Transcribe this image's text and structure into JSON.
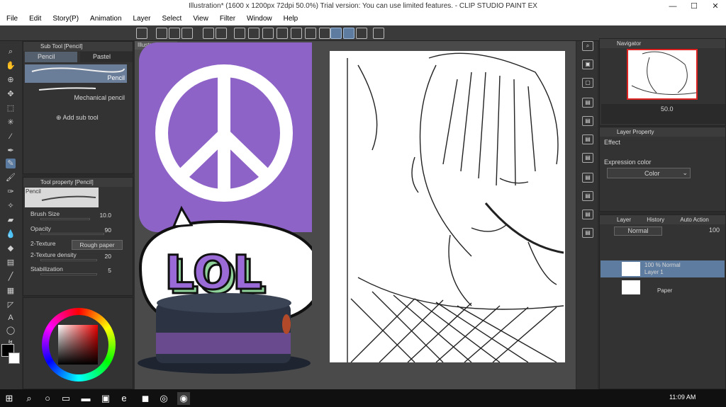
{
  "titlebar": {
    "title": "Illustration* (1600 x 1200px 72dpi 50.0%)  Trial version: You can use limited features. - CLIP STUDIO PAINT EX",
    "minimize": "—",
    "maximize": "☐",
    "close": "✕"
  },
  "menu": {
    "items": [
      "File",
      "Edit",
      "Story(P)",
      "Animation",
      "Layer",
      "Select",
      "View",
      "Filter",
      "Window",
      "Help"
    ]
  },
  "subtool": {
    "header": "Sub Tool [Pencil]",
    "tabs": [
      "Pencil",
      "Pastel"
    ],
    "brushes": [
      "Pencil",
      "Mechanical pencil"
    ],
    "add": "Add sub tool"
  },
  "toolprop": {
    "header": "Tool property [Pencil]",
    "preview_label": "Pencil",
    "brush_size_label": "Brush Size",
    "brush_size": "10.0",
    "opacity_label": "Opacity",
    "opacity": "90",
    "texture_label": "2-Texture",
    "texture_value": "Rough paper",
    "density_label": "2-Texture density",
    "density": "20",
    "stabilization_label": "Stabilization",
    "stabilization": "5"
  },
  "navigator": {
    "tab": "Navigator",
    "zoom": "50.0"
  },
  "layerprop": {
    "header": "Layer Property",
    "effect": "Effect",
    "expression": "Expression color",
    "color": "Color"
  },
  "layers": {
    "tab": "Layer",
    "history": "History",
    "auto": "Auto Action",
    "blend": "Normal",
    "opacity": "100",
    "rows": [
      {
        "top": "100 % Normal",
        "name": "Layer 1"
      },
      {
        "top": "",
        "name": "Paper"
      }
    ]
  },
  "canvas_tab": "Illustratio",
  "sticker": {
    "text": "LOL"
  },
  "taskbar": {
    "time": "11:09 AM"
  },
  "colors": {
    "accent": "#8e63c8",
    "sel": "#5e7c9f",
    "lol_fill": "#9a6ad6",
    "lol_shadow": "#8fd39a"
  }
}
